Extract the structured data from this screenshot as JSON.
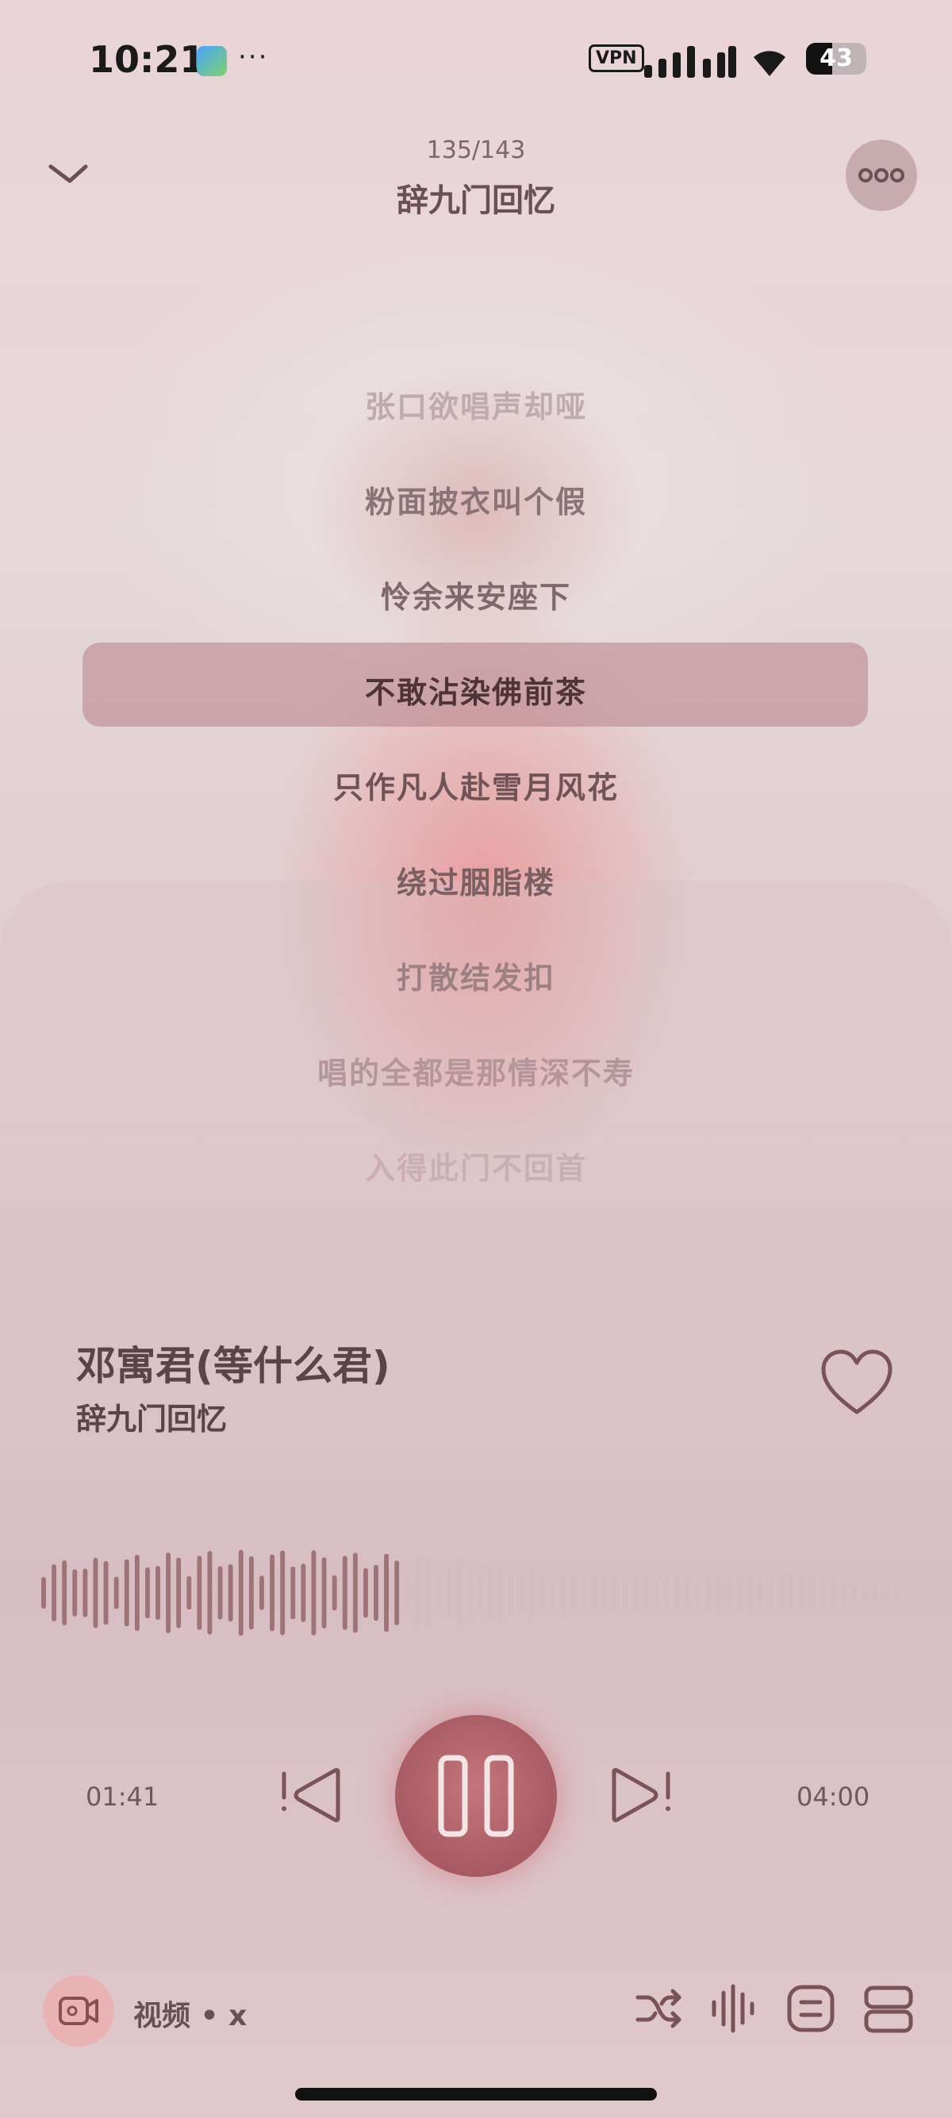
{
  "status_bar": {
    "time": "10:21",
    "more": "···",
    "vpn": "VPN",
    "battery": "43",
    "battery_level": 0.43
  },
  "header": {
    "track_count": "135/143",
    "title": "辞九门回忆"
  },
  "lyrics": [
    {
      "text": "张口欲唱声却哑",
      "color": "#bfaaad"
    },
    {
      "text": "粉面披衣叫个假",
      "color": "#8a7276"
    },
    {
      "text": "怜余来安座下",
      "color": "#7f686c"
    },
    {
      "text": "不敢沾染佛前茶",
      "color": "#4e3438",
      "current": true
    },
    {
      "text": "只作凡人赴雪月风花",
      "color": "#6f5357"
    },
    {
      "text": "绕过胭脂楼",
      "color": "#7a5f63"
    },
    {
      "text": "打散结发扣",
      "color": "#9c8084"
    },
    {
      "text": "唱的全都是那情深不寿",
      "color": "#b4959a"
    },
    {
      "text": "入得此门不回首",
      "color": "#caaeb1"
    }
  ],
  "song": {
    "title": "邓寓君(等什么君)",
    "artist": "辞九门回忆"
  },
  "player": {
    "current_time": "01:41",
    "total_time": "04:00",
    "progress": 0.42
  },
  "bottom": {
    "video_label": "视频 • x"
  },
  "colors": {
    "accent": "#a85a62",
    "played_wave": "#9e7478",
    "unplayed_wave": "#d4bcc0"
  }
}
